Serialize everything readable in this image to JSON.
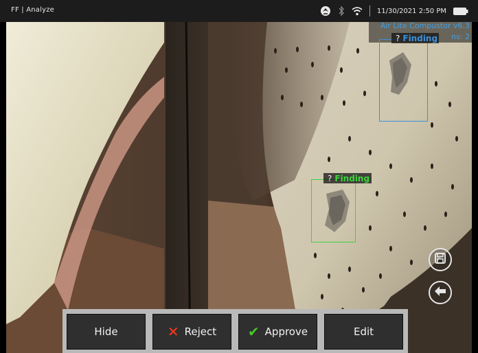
{
  "statusbar": {
    "title": "FF | Analyze",
    "datetime": "11/30/2021 2:50 PM",
    "icons": [
      "gps-icon",
      "bluetooth-icon",
      "wifi-icon",
      "battery-icon"
    ]
  },
  "overlay": {
    "model": "Air Lite Compustor v6.3",
    "count_suffix": "ns: 2"
  },
  "detections": [
    {
      "question": "?",
      "label": "Finding",
      "color": "#3d8fd8"
    },
    {
      "question": "?",
      "label": "Finding",
      "color": "#3bd43b"
    }
  ],
  "side_buttons": {
    "save_icon": "save-icon",
    "back_icon": "back-arrow-icon"
  },
  "toolbar": {
    "hide": "Hide",
    "reject": "Reject",
    "approve": "Approve",
    "edit": "Edit"
  },
  "colors": {
    "reject": "#ff3a1e",
    "approve": "#49c82a",
    "overlay_text": "#3ea0e8"
  }
}
